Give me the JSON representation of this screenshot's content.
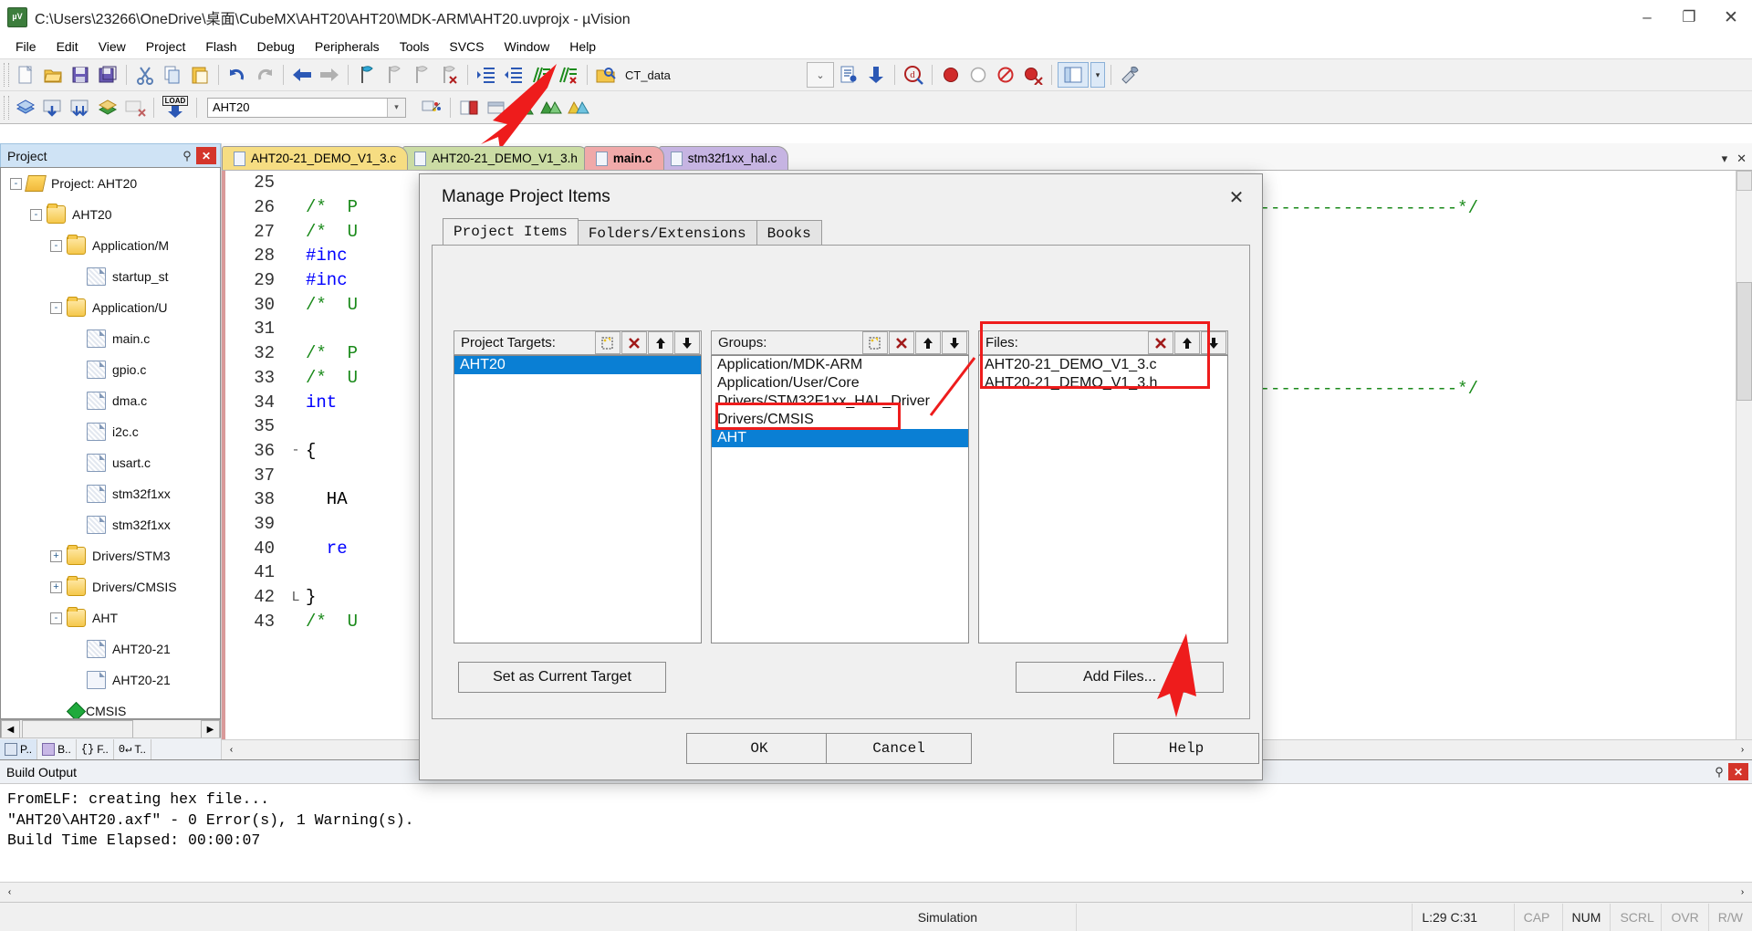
{
  "window": {
    "title": "C:\\Users\\23266\\OneDrive\\桌面\\CubeMX\\AHT20\\AHT20\\MDK-ARM\\AHT20.uvprojx - µVision",
    "app_icon": "uvision-icon",
    "minimize": "–",
    "maximize": "❐",
    "close": "✕"
  },
  "menu": [
    "File",
    "Edit",
    "View",
    "Project",
    "Flash",
    "Debug",
    "Peripherals",
    "Tools",
    "SVCS",
    "Window",
    "Help"
  ],
  "toolbar2": {
    "target_combo_value": "AHT20",
    "batch_label": "LOAD"
  },
  "toolbar1": {
    "find_combo_value": "CT_data"
  },
  "project_panel": {
    "title": "Project",
    "pin_icon": "pin-icon",
    "close_icon": "close-icon",
    "tree": [
      {
        "indent": 0,
        "expander": "-",
        "icon": "project-icon",
        "label": "Project: AHT20"
      },
      {
        "indent": 1,
        "expander": "-",
        "icon": "target-folder-icon",
        "label": "AHT20"
      },
      {
        "indent": 2,
        "expander": "-",
        "icon": "folder-icon",
        "label": "Application/M"
      },
      {
        "indent": 3,
        "expander": "",
        "icon": "file-icon",
        "label": "startup_st"
      },
      {
        "indent": 2,
        "expander": "-",
        "icon": "folder-icon",
        "label": "Application/U"
      },
      {
        "indent": 3,
        "expander": "",
        "icon": "file-icon",
        "label": "main.c"
      },
      {
        "indent": 3,
        "expander": "",
        "icon": "file-c-icon",
        "label": "gpio.c"
      },
      {
        "indent": 3,
        "expander": "",
        "icon": "file-c-icon",
        "label": "dma.c"
      },
      {
        "indent": 3,
        "expander": "",
        "icon": "file-c-icon",
        "label": "i2c.c"
      },
      {
        "indent": 3,
        "expander": "",
        "icon": "file-c-icon",
        "label": "usart.c"
      },
      {
        "indent": 3,
        "expander": "",
        "icon": "file-icon",
        "label": "stm32f1xx"
      },
      {
        "indent": 3,
        "expander": "",
        "icon": "file-icon",
        "label": "stm32f1xx"
      },
      {
        "indent": 2,
        "expander": "+",
        "icon": "folder-icon",
        "label": "Drivers/STM3"
      },
      {
        "indent": 2,
        "expander": "+",
        "icon": "folder-icon",
        "label": "Drivers/CMSIS"
      },
      {
        "indent": 2,
        "expander": "-",
        "icon": "folder-icon",
        "label": "AHT"
      },
      {
        "indent": 3,
        "expander": "",
        "icon": "file-icon",
        "label": "AHT20-21"
      },
      {
        "indent": 3,
        "expander": "",
        "icon": "file-plain-icon",
        "label": "AHT20-21"
      },
      {
        "indent": 2,
        "expander": "",
        "icon": "cmsis-icon",
        "label": "CMSIS"
      }
    ],
    "bottom_tabs": [
      {
        "icon": "project-tab-icon",
        "label": "P.."
      },
      {
        "icon": "books-tab-icon",
        "label": "B.."
      },
      {
        "icon": "functions-tab-icon",
        "label": "F.."
      },
      {
        "icon": "templates-tab-icon",
        "label": "T.."
      }
    ]
  },
  "editor": {
    "tabs": [
      {
        "label": "AHT20-21_DEMO_V1_3.c",
        "color": "yellow",
        "active": false
      },
      {
        "label": "AHT20-21_DEMO_V1_3.h",
        "color": "green",
        "active": false
      },
      {
        "label": "main.c",
        "color": "red",
        "active": true
      },
      {
        "label": "stm32f1xx_hal.c",
        "color": "purple",
        "active": false
      }
    ],
    "lines": [
      {
        "no": "25",
        "fold": "",
        "text": "",
        "cls": "c-black"
      },
      {
        "no": "26",
        "fold": "",
        "text": "/*  P",
        "cls": "c-green"
      },
      {
        "no": "27",
        "fold": "",
        "text": "/*  U",
        "cls": "c-green"
      },
      {
        "no": "28",
        "fold": "",
        "text": "#inc",
        "cls": "c-blue"
      },
      {
        "no": "29",
        "fold": "",
        "text": "#inc",
        "cls": "c-blue"
      },
      {
        "no": "30",
        "fold": "",
        "text": "/*  U",
        "cls": "c-green"
      },
      {
        "no": "31",
        "fold": "",
        "text": "",
        "cls": "c-black"
      },
      {
        "no": "32",
        "fold": "",
        "text": "/*  P",
        "cls": "c-green"
      },
      {
        "no": "33",
        "fold": "",
        "text": "/*  U",
        "cls": "c-green"
      },
      {
        "no": "34",
        "fold": "",
        "text": "int",
        "cls": "c-blue"
      },
      {
        "no": "35",
        "fold": "",
        "text": "",
        "cls": "c-black"
      },
      {
        "no": "36",
        "fold": "-",
        "text": "{",
        "cls": "c-black"
      },
      {
        "no": "37",
        "fold": "",
        "text": "",
        "cls": "c-black"
      },
      {
        "no": "38",
        "fold": "",
        "text": "  HA",
        "cls": "c-black"
      },
      {
        "no": "39",
        "fold": "",
        "text": "",
        "cls": "c-black"
      },
      {
        "no": "40",
        "fold": "",
        "text": "  re",
        "cls": "c-blue"
      },
      {
        "no": "41",
        "fold": "",
        "text": "",
        "cls": "c-black"
      },
      {
        "no": "42",
        "fold": "L",
        "text": "}",
        "cls": "c-black"
      },
      {
        "no": "43",
        "fold": "",
        "text": "/*  U",
        "cls": "c-green"
      }
    ],
    "right_comments": [
      "-----------------------------*/",
      "-----------------------------*/"
    ]
  },
  "build_output": {
    "title": "Build Output",
    "pin_icon": "pin-icon",
    "close_icon": "close-icon",
    "lines": [
      "FromELF: creating hex file...",
      "\"AHT20\\AHT20.axf\" - 0 Error(s), 1 Warning(s).",
      "Build Time Elapsed:  00:00:07"
    ]
  },
  "status_bar": {
    "simulation": "Simulation",
    "cursor": "L:29 C:31",
    "cap": "CAP",
    "num": "NUM",
    "scrl": "SCRL",
    "ovr": "OVR",
    "rw": "R/W"
  },
  "dialog": {
    "title": "Manage Project Items",
    "close_icon": "close-icon",
    "tabs": [
      {
        "label": "Project Items",
        "active": true
      },
      {
        "label": "Folders/Extensions",
        "active": false
      },
      {
        "label": "Books",
        "active": false
      }
    ],
    "project_targets": {
      "label": "Project Targets:",
      "buttons": [
        "new-item-icon",
        "delete-icon",
        "move-up-icon",
        "move-down-icon"
      ],
      "items": [
        {
          "label": "AHT20",
          "selected": true
        }
      ]
    },
    "groups": {
      "label": "Groups:",
      "buttons": [
        "new-item-icon",
        "delete-icon",
        "move-up-icon",
        "move-down-icon"
      ],
      "items": [
        {
          "label": "Application/MDK-ARM",
          "selected": false
        },
        {
          "label": "Application/User/Core",
          "selected": false
        },
        {
          "label": "Drivers/STM32F1xx_HAL_Driver",
          "selected": false
        },
        {
          "label": "Drivers/CMSIS",
          "selected": false
        },
        {
          "label": "AHT",
          "selected": true
        }
      ]
    },
    "files": {
      "label": "Files:",
      "buttons": [
        "delete-icon",
        "move-up-icon",
        "move-down-icon"
      ],
      "items": [
        {
          "label": "AHT20-21_DEMO_V1_3.c",
          "selected": false
        },
        {
          "label": "AHT20-21_DEMO_V1_3.h",
          "selected": false
        }
      ]
    },
    "set_as_current_target": "Set as Current Target",
    "add_files": "Add Files...",
    "ok": "OK",
    "cancel": "Cancel",
    "help": "Help"
  },
  "colors": {
    "selection_blue": "#0a7fd4",
    "annotation_red": "#ee1c1c",
    "panel_header_blue": "#cfe3f5",
    "dialog_bg": "#f0f0f0"
  }
}
